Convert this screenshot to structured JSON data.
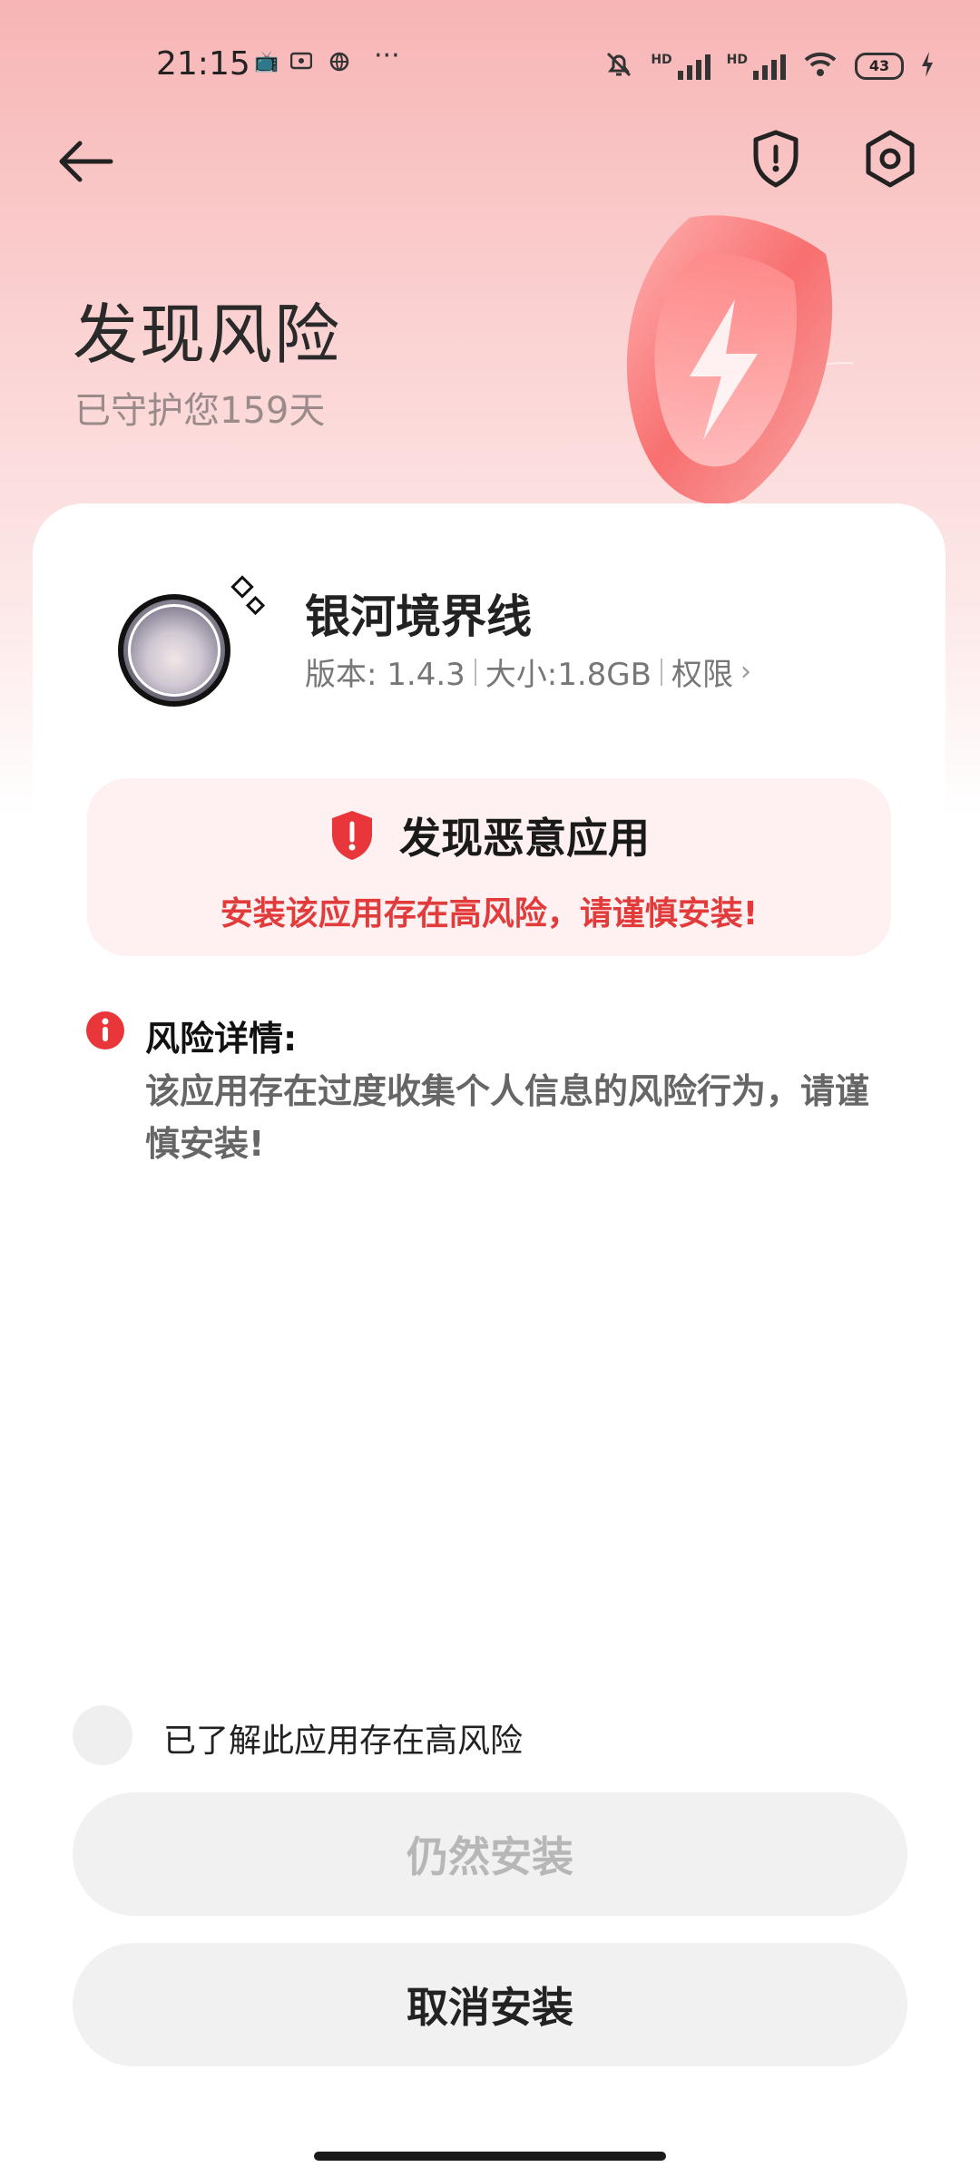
{
  "status_bar": {
    "time": "21:15",
    "hd1": "HD",
    "hd2": "HD",
    "battery": "43",
    "icons": [
      "tv-icon",
      "video-icon",
      "globe-icon",
      "more-icon",
      "bell-muted-icon",
      "signal-icon",
      "wifi-icon",
      "battery-icon",
      "charging-icon"
    ]
  },
  "header": {
    "title": "发现风险",
    "subtitle": "已守护您159天"
  },
  "app": {
    "name": "银河境界线",
    "version": "版本: 1.4.3",
    "size": "大小:1.8GB",
    "permissions": "权限"
  },
  "alert": {
    "title": "发现恶意应用",
    "subtitle": "安装该应用存在高风险，请谨慎安装!"
  },
  "risk": {
    "label": "风险详情:",
    "detail": "该应用存在过度收集个人信息的风险行为，请谨慎安装!"
  },
  "confirm": {
    "label": "已了解此应用存在高风险"
  },
  "buttons": {
    "install": "仍然安装",
    "cancel": "取消安装"
  },
  "colors": {
    "accent_red": "#e23b3b",
    "shield_red": "#f25a5a",
    "alert_bg": "#fff1f1",
    "button_bg": "#f1f1f1"
  }
}
